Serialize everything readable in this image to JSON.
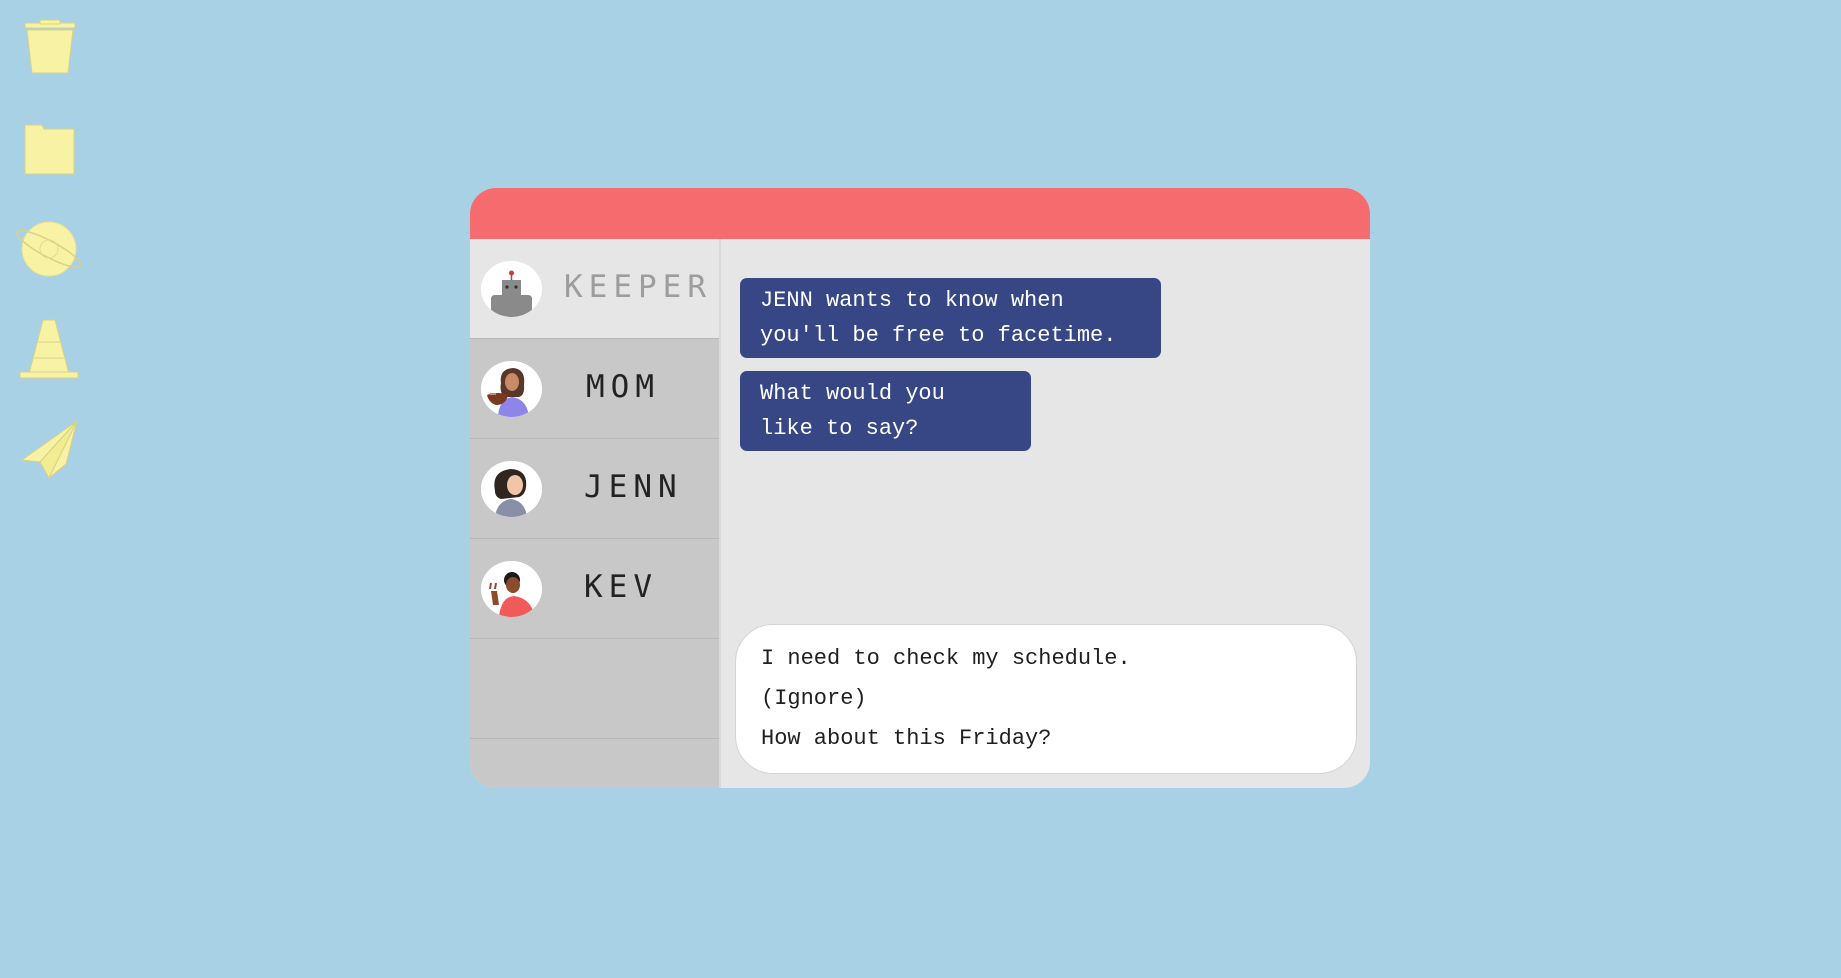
{
  "desktop": {
    "icons": [
      {
        "name": "trash-icon"
      },
      {
        "name": "folder-icon"
      },
      {
        "name": "planet-icon"
      },
      {
        "name": "traffic-cone-icon"
      },
      {
        "name": "paper-plane-icon"
      }
    ],
    "icon_color": "#f8f3a4"
  },
  "window": {
    "titlebar_color": "#f66b6d",
    "contacts": [
      {
        "name": "KEEPER",
        "avatar": "robot-avatar",
        "active": true
      },
      {
        "name": "MOM",
        "avatar": "mom-avatar",
        "active": false
      },
      {
        "name": "JENN",
        "avatar": "jenn-avatar",
        "active": false
      },
      {
        "name": "KEV",
        "avatar": "kev-avatar",
        "active": false
      }
    ],
    "messages": [
      {
        "text": "JENN wants to know when\nyou'll be free to facetime."
      },
      {
        "text": "What would you\nlike to say?"
      }
    ],
    "bubble_color": "#374685",
    "reply_options": [
      "I need to check my schedule.",
      "(Ignore)",
      "How about this Friday?"
    ]
  }
}
